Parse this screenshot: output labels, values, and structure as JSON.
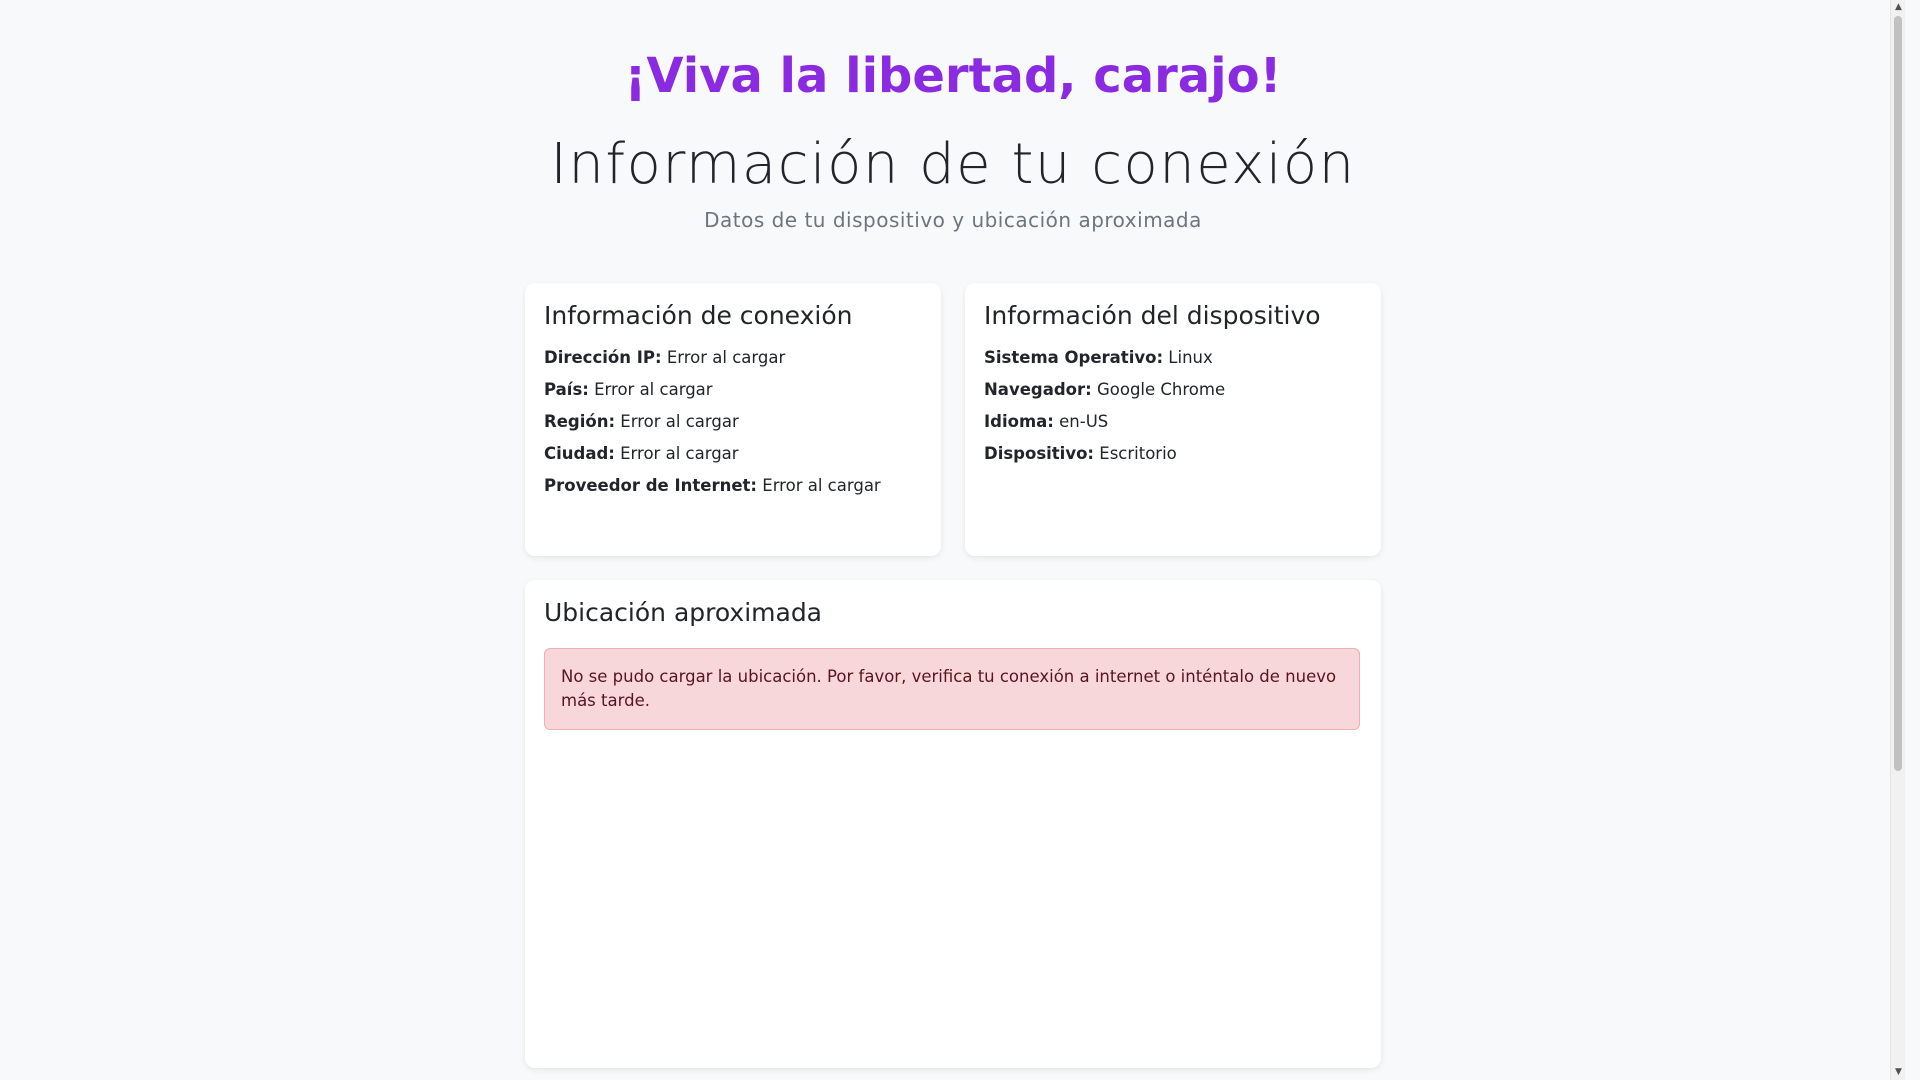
{
  "header": {
    "slogan": "¡Viva la libertad, carajo!",
    "title": "Información de tu conexión",
    "subtitle": "Datos de tu dispositivo y ubicación aproximada"
  },
  "connection_card": {
    "title": "Información de conexión",
    "rows": [
      {
        "label": "Dirección IP:",
        "value": "Error al cargar"
      },
      {
        "label": "País:",
        "value": "Error al cargar"
      },
      {
        "label": "Región:",
        "value": "Error al cargar"
      },
      {
        "label": "Ciudad:",
        "value": "Error al cargar"
      },
      {
        "label": "Proveedor de Internet:",
        "value": "Error al cargar"
      }
    ]
  },
  "device_card": {
    "title": "Información del dispositivo",
    "rows": [
      {
        "label": "Sistema Operativo:",
        "value": "Linux"
      },
      {
        "label": "Navegador:",
        "value": "Google Chrome"
      },
      {
        "label": "Idioma:",
        "value": "en-US"
      },
      {
        "label": "Dispositivo:",
        "value": "Escritorio"
      }
    ]
  },
  "location_card": {
    "title": "Ubicación aproximada",
    "error": "No se pudo cargar la ubicación. Por favor, verifica tu conexión a internet o inténtalo de nuevo más tarde."
  },
  "scrollbar": {
    "up_icon": "▲",
    "down_icon": "▼"
  },
  "colors": {
    "accent": "#8a2be2",
    "background": "#f8f9fa",
    "alert_bg": "#f8d7da",
    "alert_text": "#58151c"
  }
}
